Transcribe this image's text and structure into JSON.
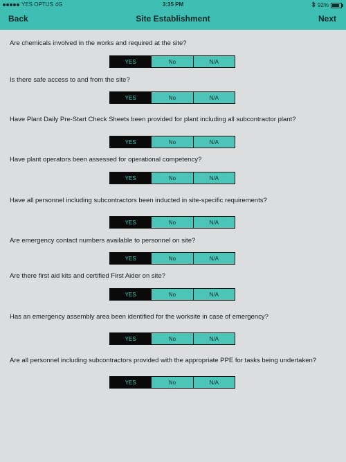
{
  "status": {
    "carrier": "YES OPTUS",
    "network": "4G",
    "time": "3:35 PM",
    "bluetooth": "∦",
    "battery": "92%"
  },
  "nav": {
    "back": "Back",
    "title": "Site Establishment",
    "next": "Next"
  },
  "colors": {
    "header": "#3fbfb4",
    "segment": "#4dc4b8",
    "selected": "#0a0a0a",
    "background": "#dcdddf"
  },
  "options": [
    "YES",
    "No",
    "N/A"
  ],
  "questions": [
    {
      "text": "Are chemicals involved in the works and required at the site?",
      "selected": "YES"
    },
    {
      "text": "Is there safe access to and from the site?",
      "selected": "YES"
    },
    {
      "text": "Have Plant Daily Pre-Start Check Sheets been provided for plant including all subcontractor plant?",
      "selected": "YES"
    },
    {
      "text": "Have plant operators been assessed for operational competency?",
      "selected": "YES"
    },
    {
      "text": "Have all personnel including subcontractors been inducted in site-specific requirements?",
      "selected": "YES"
    },
    {
      "text": "Are emergency contact numbers available to personnel on site?",
      "selected": "YES"
    },
    {
      "text": "Are there first aid kits and certified First Aider on site?",
      "selected": "YES"
    },
    {
      "text": "Has an emergency assembly area been identified for the worksite in case of emergency?",
      "selected": "YES"
    },
    {
      "text": "Are all personnel including subcontractors provided with the appropriate PPE for tasks being undertaken?",
      "selected": "YES"
    }
  ]
}
